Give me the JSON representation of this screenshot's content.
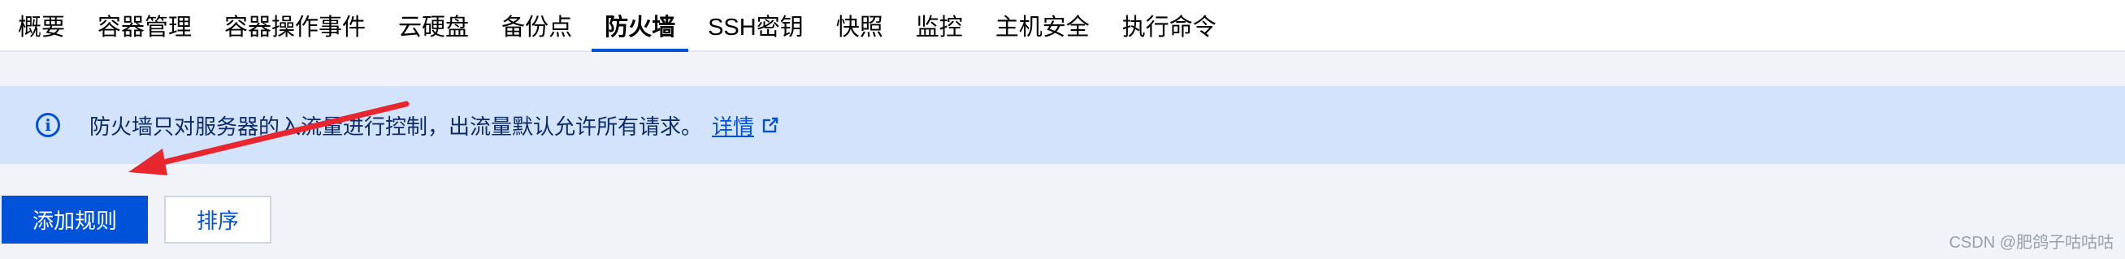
{
  "tabs": [
    {
      "label": "概要"
    },
    {
      "label": "容器管理"
    },
    {
      "label": "容器操作事件"
    },
    {
      "label": "云硬盘"
    },
    {
      "label": "备份点"
    },
    {
      "label": "防火墙",
      "active": true
    },
    {
      "label": "SSH密钥"
    },
    {
      "label": "快照"
    },
    {
      "label": "监控"
    },
    {
      "label": "主机安全"
    },
    {
      "label": "执行命令"
    }
  ],
  "notice": {
    "icon": "info-icon",
    "text": "防火墙只对服务器的入流量进行控制，出流量默认允许所有请求。",
    "link_label": "详情",
    "link_icon": "external-link-icon"
  },
  "actions": {
    "add_rule_label": "添加规则",
    "sort_label": "排序"
  },
  "annotation": {
    "arrow_color": "#e8262e"
  },
  "watermark": "CSDN @肥鸽子咕咕咕",
  "colors": {
    "primary": "#0052d9",
    "notice_bg": "#d4e3fc",
    "page_bg": "#f2f3f8"
  }
}
